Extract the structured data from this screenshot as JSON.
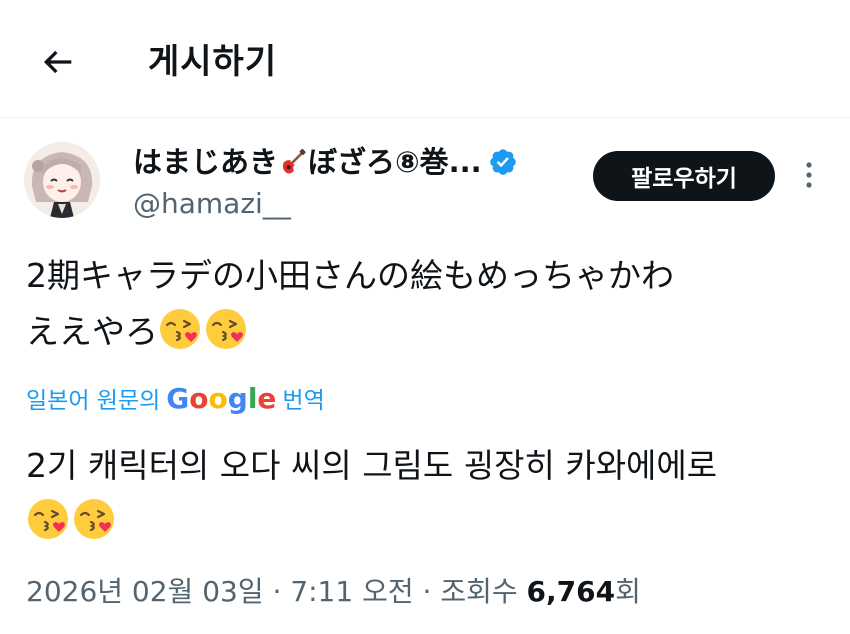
{
  "header": {
    "title": "게시하기"
  },
  "author": {
    "name_part1": "はまじあき",
    "name_part2": "ぼざろ⑧巻...",
    "handle": "@hamazi__",
    "verified": true,
    "follow_label": "팔로우하기"
  },
  "tweet": {
    "line1": "2期キャラデの小田さんの絵もめっちゃかわ",
    "line2": "ええやろ"
  },
  "translate": {
    "prefix": "일본어 원문의",
    "brand": "Google",
    "suffix": "번역"
  },
  "translation": {
    "line1": "2기 캐릭터의 오다 씨의 그림도 굉장히 카와에에로"
  },
  "meta": {
    "date": "2026년 02월 03일",
    "time": "7:11 오전",
    "views_label": "조회수",
    "views_count": "6,764",
    "views_suffix": "회",
    "separator": " · "
  },
  "colors": {
    "text": "#0f1419",
    "secondary": "#536471",
    "link": "#1d9bf0",
    "follow_bg": "#0f1419",
    "verified": "#1d9bf0",
    "google": [
      "#4285F4",
      "#EA4335",
      "#FBBC05",
      "#4285F4",
      "#34A853",
      "#EA4335"
    ]
  },
  "icons": {
    "back": "arrow-left-icon",
    "verified": "verified-badge-icon",
    "more": "more-vertical-icon",
    "emoji": "face-blowing-kiss-emoji",
    "guitar": "guitar-emoji"
  }
}
